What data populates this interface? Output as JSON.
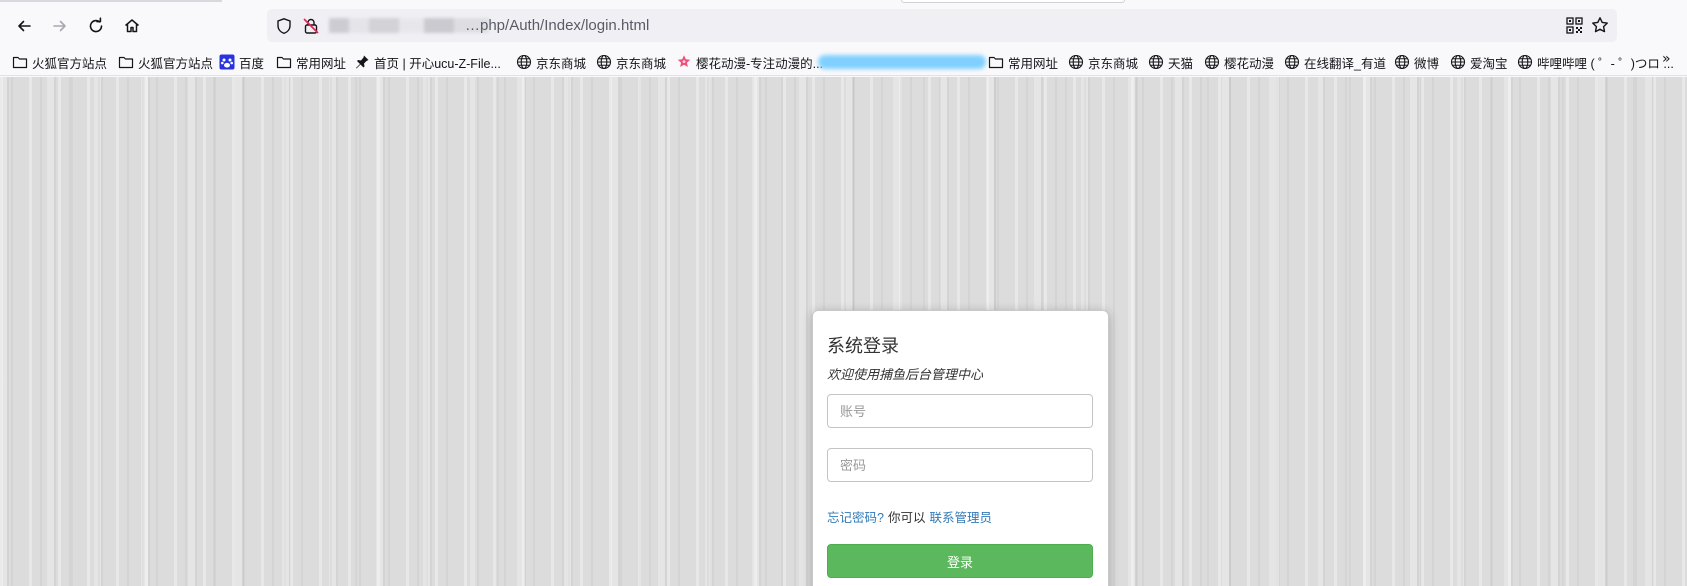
{
  "browser": {
    "url_text": "…php/Auth/Index/login.html",
    "bookmarks": [
      {
        "label": "火狐官方站点",
        "icon": "folder-icon"
      },
      {
        "label": "火狐官方站点",
        "icon": "folder-icon"
      },
      {
        "label": "百度",
        "icon": "baidu-paw-icon"
      },
      {
        "label": "常用网址",
        "icon": "folder-icon"
      },
      {
        "label": "首页 | 开心ucu-Z-File...",
        "icon": "pin-icon"
      },
      {
        "label": "京东商城",
        "icon": "globe-icon"
      },
      {
        "label": "京东商城",
        "icon": "globe-icon"
      },
      {
        "label": "樱花动漫-专注动漫的...",
        "icon": "sakura-icon"
      },
      {
        "label": "常用网址",
        "icon": "folder-icon"
      },
      {
        "label": "京东商城",
        "icon": "globe-icon"
      },
      {
        "label": "天猫",
        "icon": "globe-icon"
      },
      {
        "label": "樱花动漫",
        "icon": "globe-icon"
      },
      {
        "label": "在线翻译_有道",
        "icon": "globe-icon"
      },
      {
        "label": "微博",
        "icon": "globe-icon"
      },
      {
        "label": "爱淘宝",
        "icon": "globe-icon"
      },
      {
        "label": "哔哩哔哩 ( ゜- ゜)つロ ...",
        "icon": "globe-icon"
      }
    ],
    "overflow_label": "»"
  },
  "login": {
    "title": "系统登录",
    "subtitle": "欢迎使用捕鱼后台管理中心",
    "account_placeholder": "账号",
    "password_placeholder": "密码",
    "forgot_link": "忘记密码?",
    "help_text": "你可以",
    "contact_link": "联系管理员",
    "submit_label": "登录"
  },
  "colors": {
    "button_green": "#5cb85c",
    "link_blue": "#337ab7",
    "page_background": "#dcdcdc"
  }
}
